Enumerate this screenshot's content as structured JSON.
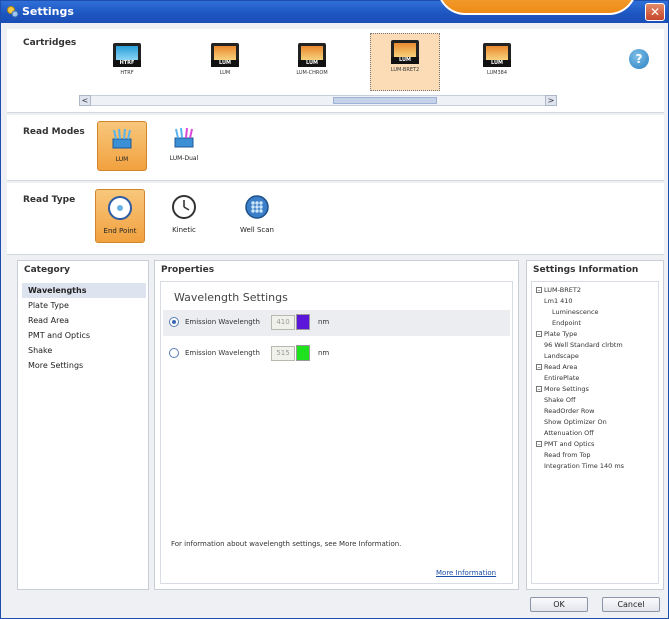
{
  "window": {
    "title": "Settings"
  },
  "cartridges": {
    "label": "Cartridges",
    "items": [
      {
        "icon_text": "HTRF",
        "caption": "HTRF"
      },
      {
        "icon_text": "LUM",
        "caption": "LUM"
      },
      {
        "icon_text": "LUM",
        "caption": "LUM-CHROM"
      },
      {
        "icon_text": "LUM",
        "caption": "LUM-BRET2",
        "selected": true
      },
      {
        "icon_text": "LUM",
        "caption": "LUM384"
      }
    ],
    "scroll_left": "<",
    "scroll_right": ">"
  },
  "help": {
    "label": "?"
  },
  "read_modes": {
    "label": "Read Modes",
    "items": [
      {
        "caption": "LUM",
        "selected": true
      },
      {
        "caption": "LUM-Dual"
      }
    ]
  },
  "read_type": {
    "label": "Read Type",
    "items": [
      {
        "caption": "End Point",
        "selected": true
      },
      {
        "caption": "Kinetic"
      },
      {
        "caption": "Well Scan"
      }
    ]
  },
  "category": {
    "header": "Category",
    "items": [
      "Wavelengths",
      "Plate Type",
      "Read Area",
      "PMT and Optics",
      "Shake",
      "More Settings"
    ],
    "selected": "Wavelengths"
  },
  "properties": {
    "header": "Properties",
    "title": "Wavelength Settings",
    "rows": [
      {
        "label": "Emission Wavelength",
        "value": "410",
        "unit": "nm",
        "color": "#5b16d9",
        "selected": true
      },
      {
        "label": "Emission Wavelength",
        "value": "515",
        "unit": "nm",
        "color": "#1fe21f",
        "selected": false
      }
    ],
    "info": "For information about wavelength settings, see More Information.",
    "link": "More Information"
  },
  "settings_info": {
    "header": "Settings Information",
    "lines": [
      {
        "text": "LUM-BRET2",
        "box": true,
        "indent": 0
      },
      {
        "text": "Lm1    410",
        "indent": 1
      },
      {
        "text": "Luminescence",
        "indent": 2
      },
      {
        "text": "Endpoint",
        "indent": 2
      },
      {
        "text": "Plate Type",
        "box": true,
        "indent": 0
      },
      {
        "text": "96 Well Standard clrbtm",
        "indent": 1
      },
      {
        "text": "Landscape",
        "indent": 1
      },
      {
        "text": "Read Area",
        "box": true,
        "indent": 0
      },
      {
        "text": "EntirePlate",
        "indent": 1
      },
      {
        "text": "More Settings",
        "box": true,
        "indent": 0
      },
      {
        "text": "Shake  Off",
        "indent": 1
      },
      {
        "text": "ReadOrder  Row",
        "indent": 1
      },
      {
        "text": "Show Optimizer  On",
        "indent": 1
      },
      {
        "text": "Attenuation  Off",
        "indent": 1
      },
      {
        "text": "PMT and Optics",
        "box": true,
        "indent": 0
      },
      {
        "text": "Read from  Top",
        "indent": 1
      },
      {
        "text": "Integration Time  140 ms",
        "indent": 1
      }
    ]
  },
  "buttons": {
    "ok": "OK",
    "cancel": "Cancel"
  },
  "colors": {
    "accent": "#f1a13f",
    "titlebar": "#1d55c0",
    "link": "#1a4ea8"
  }
}
